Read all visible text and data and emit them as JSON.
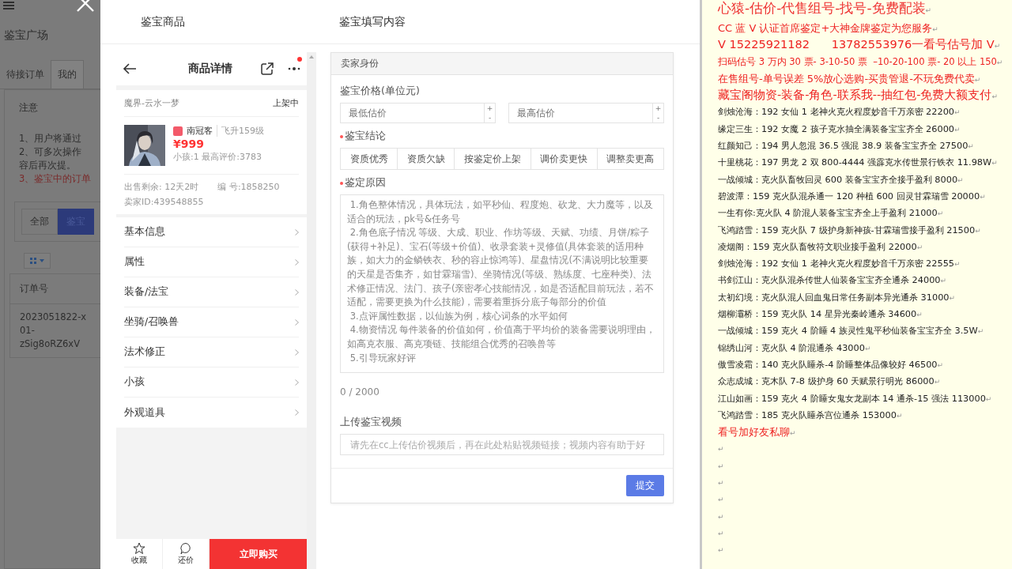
{
  "background": {
    "title": "鉴宝广场",
    "tabs": [
      {
        "label": "待接订单",
        "selected": false
      },
      {
        "label": "我的",
        "selected": true
      }
    ],
    "notice_title": "注意",
    "notice_lines": [
      {
        "text": "1、用户将通过",
        "kind": "normal"
      },
      {
        "text": "2、可多次操作",
        "kind": "normal"
      },
      {
        "text": "容后再次提。",
        "kind": "normal"
      },
      {
        "text": "3、鉴宝中的订单",
        "kind": "warn"
      }
    ],
    "filters": [
      {
        "label": "全部",
        "selected": false
      },
      {
        "label": "鉴宝",
        "selected": true
      }
    ],
    "table": {
      "columns": [
        "订单号"
      ],
      "rows": [
        [
          "2023051822-x\n01-\nzSig8oRZ6xV"
        ]
      ]
    }
  },
  "modal": {
    "left_title": "鉴宝商品",
    "right_title": "鉴宝填写内容"
  },
  "product": {
    "header": "商品详情",
    "has_notification": true,
    "server": "魔界-云水一梦",
    "status": "上架中",
    "name": "南冠客",
    "level": "飞升159级",
    "price": "¥999",
    "stats": "小孩:1 最高评价:3783",
    "remaining": "出售剩余: 12天2时",
    "number": "编 号:1858250",
    "seller": "卖家ID:439548855",
    "menu": [
      "基本信息",
      "属性",
      "装备/法宝",
      "坐骑/召唤兽",
      "法术修正",
      "小孩",
      "外观道具"
    ],
    "actions": [
      {
        "label": "收藏",
        "kind": "favorite"
      },
      {
        "label": "还价",
        "kind": "bargain"
      }
    ],
    "buy": "立即购买"
  },
  "form": {
    "section": "卖家身份",
    "price_label": "鉴宝价格(单位元)",
    "price_fields": [
      {
        "placeholder": "最低估价",
        "up": "+",
        "down": "-"
      },
      {
        "placeholder": "最高估价",
        "up": "+",
        "down": "-"
      }
    ],
    "conclusion_label": "鉴宝结论",
    "conclusion_required": true,
    "conclusions": [
      "资质优秀",
      "资质欠缺",
      "按鉴定价上架",
      "调价卖更快",
      "调整卖更高"
    ],
    "reason_label": "鉴定原因",
    "reason_required": true,
    "reason_placeholder": " 1.角色整体情况，具体玩法，如平秒仙、程度炮、砍龙、大力魔等，以及适合的玩法，pk号&任务号\n 2.角色底子情况 等级、大成、职业、作坊等级、天赋、功绩、月饼/粽子(获得+补足)、宝石(等级+价值)、收录套装+灵修值(具体套装的适用种族，如大力的金鳞铁衣、秒的容止惊鸿等)、星盘情况(不满说明比较重要的天星是否集齐，如甘霖瑞雪)、坐骑情况(等级、熟练度、七座种类)、法术修正情况、法门、孩子(亲密孝心技能情况，如是否适配目前玩法，若不适配，需要更换为什么技能)，需要着重拆分底子每部分的价值\n 3.点评属性数据，以仙族为例，核心词条的水平如何\n 4.物资情况 每件装备的价值如何，价值高于平均价的装备需要说明理由，如高克衣服、高克项链、技能组合优秀的召唤兽等\n 5.引导玩家好评",
    "counter": "0 / 2000",
    "video_label": "上传鉴宝视频",
    "video_placeholder": "请先在cc上传估价视频后，再在此处粘贴视频链接；视频内容有助于好",
    "submit": "提交"
  },
  "document": {
    "lines": [
      {
        "kind": "title",
        "text": "心猿-估价-代售组号-找号-免费配装",
        "mark": "↵"
      },
      {
        "kind": "red",
        "text": "CC 蓝 V 认证首席鉴定+大神金牌鉴定为您服务",
        "mark": "↵"
      },
      {
        "kind": "red-large",
        "text": "V 15225921182      13782553976一看号估号加 V",
        "mark": "↵"
      },
      {
        "kind": "red-small",
        "text": "扫码估号 3 万内 30 票- 3-10-50 票  –10-20-100 票- 20 以上 150",
        "mark": "↵"
      },
      {
        "kind": "red",
        "text": "在售组号-单号误差 5%放心选购-买贵管退-不玩免费代卖",
        "mark": "↵"
      },
      {
        "kind": "red-large",
        "text": "藏宝阁物资-装备-角色-联系我--抽红包-免费大额支付",
        "mark": "↵"
      },
      {
        "kind": "normal",
        "text": "剑烛沧海：192 女仙 1 老神火克火程度妙音千万亲密 22200",
        "mark": "↵"
      },
      {
        "kind": "normal",
        "text": "缘定三生：192 女魔 2 孩子克水抽全满装备宝宝齐全 26000",
        "mark": "↵"
      },
      {
        "kind": "normal",
        "text": "红颜知己：194 男人忽混 36.5 强混 38.9 装备宝宝齐全 27500",
        "mark": "↵"
      },
      {
        "kind": "normal",
        "text": "十里桃花：197 男龙 2 双 800-4444 强霹克水传世景行铁衣 11.98W",
        "mark": "↵"
      },
      {
        "kind": "normal",
        "text": "一战倾城：克火队畜牧回灵 600 装备宝宝齐全接手盈利 8000",
        "mark": "↵"
      },
      {
        "kind": "normal",
        "text": "碧波潭：159 克火队混杀通一 120 种植 600 回灵甘霖瑞雪 20000",
        "mark": "↵"
      },
      {
        "kind": "normal",
        "text": "一生有你:克火队 4 阶混人装备宝宝齐全上手盈利 21000",
        "mark": "↵"
      },
      {
        "kind": "normal",
        "text": "飞鸿踏雪：159 克火队 7 级护身新神孩-甘霖瑞雪接手盈利 21500",
        "mark": "↵"
      },
      {
        "kind": "normal",
        "text": "凌烟阁：159 克火队畜牧符文职业接手盈利 22000",
        "mark": "↵"
      },
      {
        "kind": "normal",
        "text": "剑烛沧海：192 女仙 1 老神火克火程度妙音千万亲密 22555",
        "mark": "↵"
      },
      {
        "kind": "normal",
        "text": "书剑江山：克火队混杀传世人仙装备宝宝齐全通杀 24000",
        "mark": "↵"
      },
      {
        "kind": "normal",
        "text": "太初幻境：克火队混人回血鬼日常任务副本异光通杀 31000",
        "mark": "↵"
      },
      {
        "kind": "normal",
        "text": "烟柳灞桥：159 克火队 14 星异光秦岭通杀 34600",
        "mark": "↵"
      },
      {
        "kind": "normal",
        "text": "一战倾城：159 克火 4 阶睡 4 族灵性鬼平秒仙装备宝宝齐全 3.5W",
        "mark": "↵"
      },
      {
        "kind": "normal",
        "text": "锦绣山河：克火队 4 阶混通杀 43000",
        "mark": "↵"
      },
      {
        "kind": "normal",
        "text": "傲雪凌霜：140 克火队睡杀-4 阶睡整体品像较好 46500",
        "mark": "↵"
      },
      {
        "kind": "normal",
        "text": "众志成城：克木队 7-8 级护身 60 天赋景行明光 86000",
        "mark": "↵"
      },
      {
        "kind": "normal",
        "text": "江山如画：159 克火 4 阶睡女鬼女龙副本 14 通杀-15 强法 113000",
        "mark": "↵"
      },
      {
        "kind": "normal",
        "text": "飞鸿踏雪：185 克火队睡杀宫位通杀 153000",
        "mark": "↵"
      },
      {
        "kind": "red",
        "text": "看号加好友私聊",
        "mark": "↵"
      },
      {
        "kind": "empty",
        "mark": "↵"
      },
      {
        "kind": "empty",
        "mark": "↵"
      },
      {
        "kind": "empty",
        "mark": "↵"
      },
      {
        "kind": "empty",
        "mark": "↵"
      },
      {
        "kind": "empty",
        "mark": "↵"
      },
      {
        "kind": "empty",
        "mark": "↵"
      },
      {
        "kind": "empty",
        "mark": "↵"
      }
    ]
  }
}
